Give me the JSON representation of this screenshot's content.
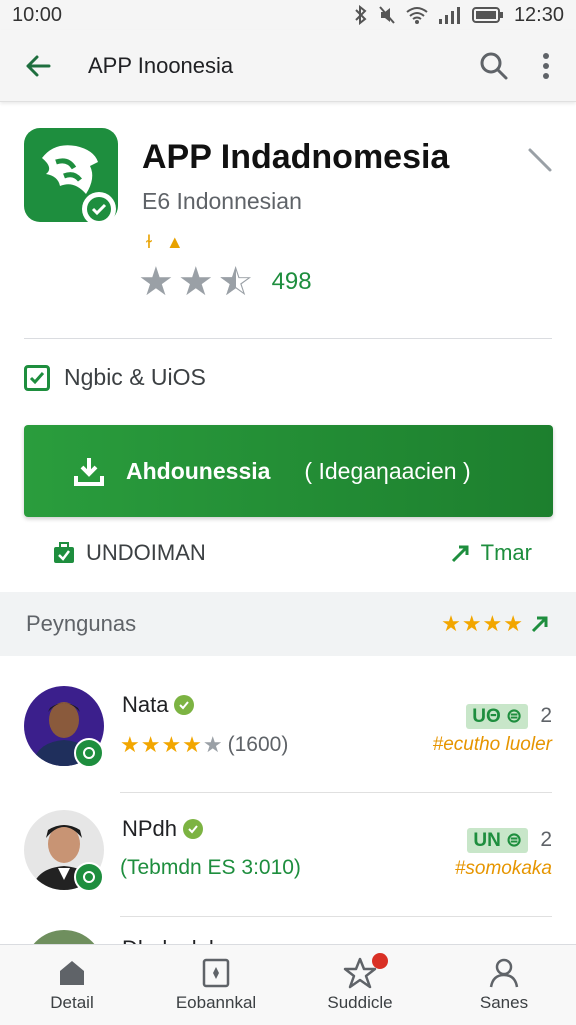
{
  "status_bar": {
    "time_left": "10:00",
    "time_right": "12:30"
  },
  "app_bar": {
    "title": "APP Inoonesia",
    "back_icon": "arrow-left-icon",
    "search_icon": "search-icon",
    "menu_icon": "more-vert-icon"
  },
  "app": {
    "name": "APP Indadnomesia",
    "developer": "E6 Indonnesian",
    "rating_count": "498",
    "rating_stars": 2.5
  },
  "compatibility": {
    "label": "Ngbic & UiOS"
  },
  "install": {
    "label": "Ahdounessia",
    "sub": "( Idegaηaacien )"
  },
  "actions": {
    "left_label": "UNDOIMAN",
    "right_label": "Tmar"
  },
  "reviews_section": {
    "title": "Peyngunas",
    "stars": "★★★★"
  },
  "reviews": [
    {
      "name": "Nata",
      "stars_text": "★★★★",
      "stars_gray": "★",
      "count": "(1600)",
      "badge": "UΘ ⊜",
      "num": "2",
      "sub": "#ecutho luoler"
    },
    {
      "name": "NPdh",
      "line": "(Tebmdn ES 3:010)",
      "badge": "UΝ ⊜",
      "num": "2",
      "sub": "#somokaka"
    }
  ],
  "peek_review": {
    "name": "Dhulaalohar"
  },
  "bottom_nav": [
    {
      "label": "Detail",
      "icon": "home-icon"
    },
    {
      "label": "Eobannkal",
      "icon": "bookmark-icon"
    },
    {
      "label": "Suddicle",
      "icon": "star-icon"
    },
    {
      "label": "Sanes",
      "icon": "person-icon"
    }
  ],
  "colors": {
    "accent": "#1e8e3e",
    "star": "#f2a600",
    "badge": "#d93025"
  }
}
